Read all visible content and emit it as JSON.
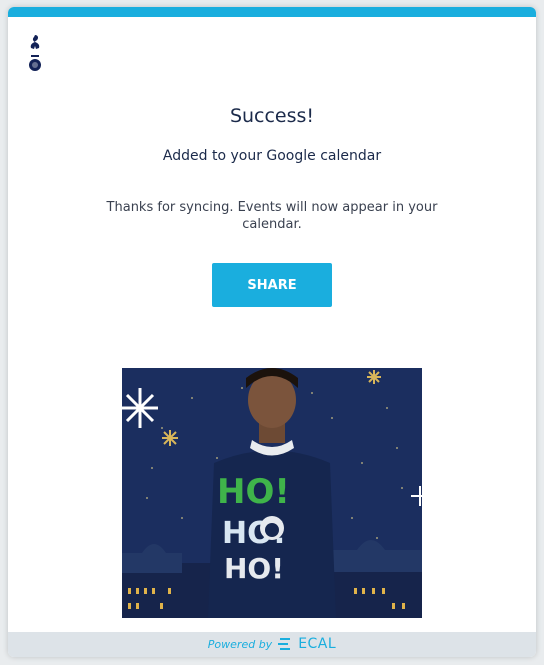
{
  "header": {
    "accent_color": "#1aaede",
    "logo": "cockerel-crest-icon"
  },
  "dialog": {
    "title": "Success!",
    "subtitle": "Added to your Google calendar",
    "message": "Thanks for syncing. Events will now appear in your calendar.",
    "share_label": "SHARE"
  },
  "promo": {
    "image": "christmas-jumper-photo",
    "jumper_text": [
      "HO!",
      "HO!",
      "HO!"
    ]
  },
  "footer": {
    "powered_by": "Powered by",
    "brand": "ECAL",
    "brand_color": "#1aaede"
  }
}
